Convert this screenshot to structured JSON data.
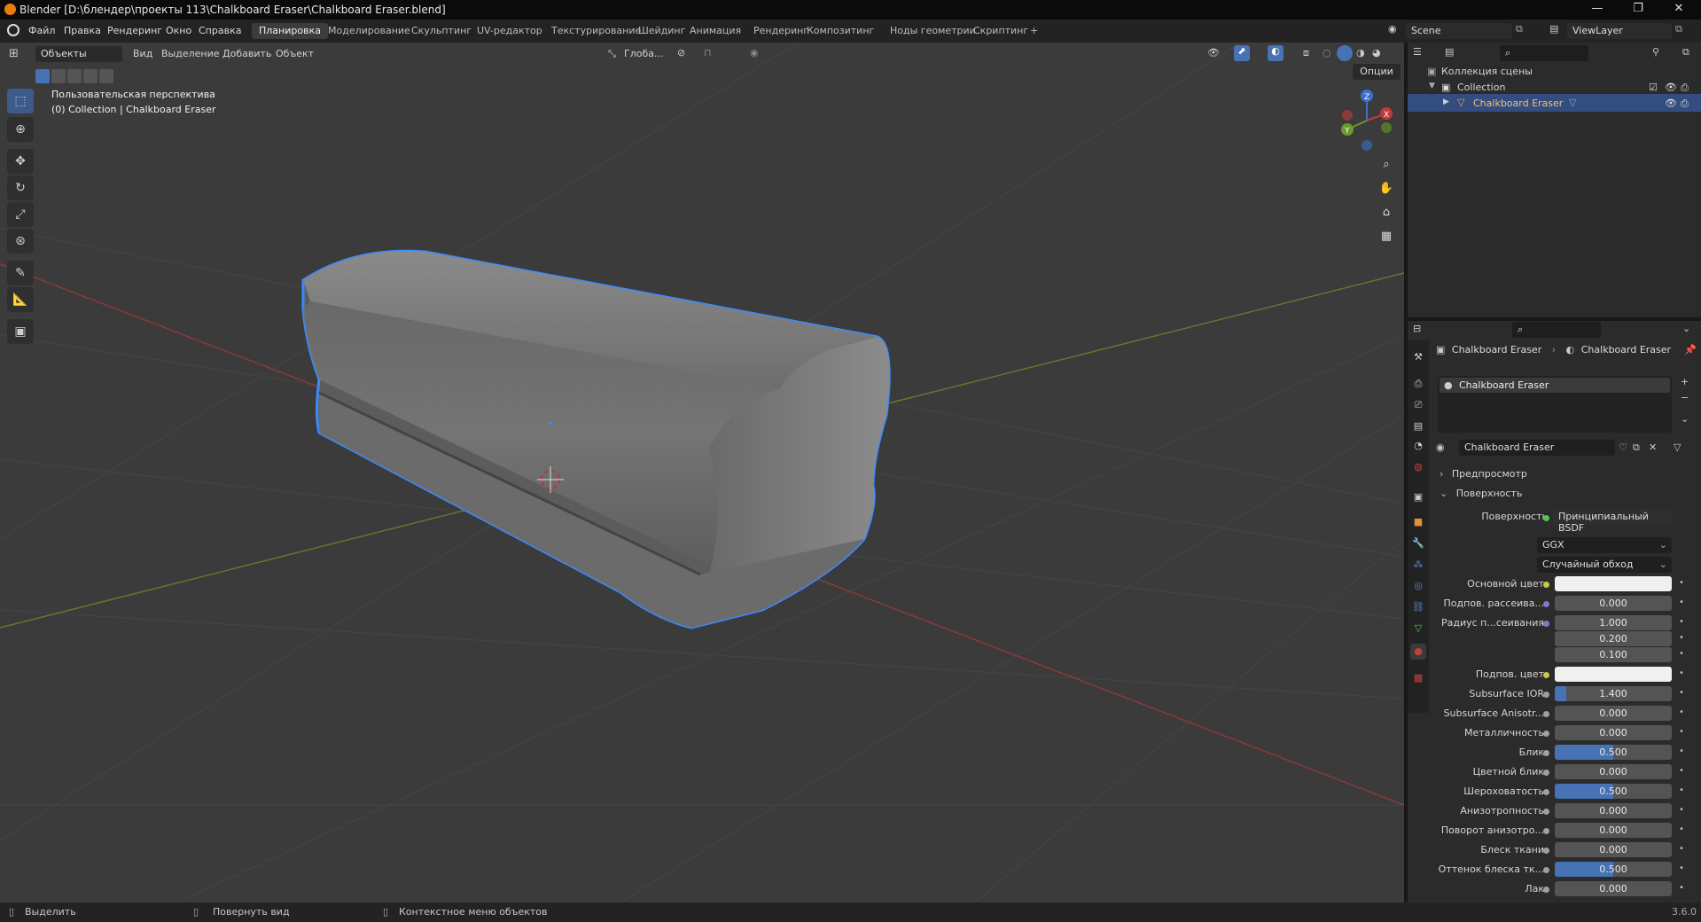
{
  "window": {
    "title": "Blender [D:\\блендер\\проекты 113\\Chalkboard Eraser\\Chalkboard Eraser.blend]",
    "minimize": "—",
    "maximize": "❐",
    "close": "✕"
  },
  "menu": {
    "items": [
      "Файл",
      "Правка",
      "Рендеринг",
      "Окно",
      "Справка"
    ],
    "workspaces": [
      "Планировка",
      "Моделирование",
      "Скульптинг",
      "UV-редактор",
      "Текстурирование",
      "Шейдинг",
      "Анимация",
      "Рендеринг",
      "Композитинг",
      "Ноды геометрии",
      "Скриптинг",
      "+"
    ],
    "active_workspace_index": 0,
    "scene_label": "Scene",
    "viewlayer_label": "ViewLayer"
  },
  "viewport": {
    "mode": "Объекты",
    "header_menus": [
      "Вид",
      "Выделение",
      "Добавить",
      "Объект"
    ],
    "transform_orientation": "Глоба...",
    "options": "Опции",
    "view_name": "Пользовательская перспектива",
    "collection_info": "(0) Collection | Chalkboard Eraser",
    "gizmo_labels": {
      "x": "X",
      "y": "Y",
      "z": "Z"
    }
  },
  "outliner": {
    "scene_collection": "Коллекция сцены",
    "collection": "Collection",
    "object": "Chalkboard Eraser"
  },
  "properties": {
    "breadcrumb_object": "Chalkboard Eraser",
    "breadcrumb_material": "Chalkboard Eraser",
    "slot_name": "Chalkboard Eraser",
    "material_name": "Chalkboard Eraser",
    "sections": {
      "preview": "Предпросмотр",
      "surface": "Поверхность"
    },
    "surface_label": "Поверхность",
    "surface_value": "Принципиальный BSDF",
    "distribution": "GGX",
    "subsurface_method": "Случайный обход",
    "fields": [
      {
        "label": "Основной цвет",
        "value": "",
        "type": "color",
        "color": "#f0f0f0",
        "dot": "#c8c84a"
      },
      {
        "label": "Подпов. рассеива...",
        "value": "0.000",
        "type": "num",
        "fill": 0,
        "dot": "#7a7acc"
      },
      {
        "label": "Радиус п...сеивания",
        "value": "1.000",
        "type": "num",
        "fill": 0,
        "dot": "#7a7acc"
      },
      {
        "label": "",
        "value": "0.200",
        "type": "num",
        "fill": 0,
        "dot": ""
      },
      {
        "label": "",
        "value": "0.100",
        "type": "num",
        "fill": 0,
        "dot": ""
      },
      {
        "label": "Подпов. цвет",
        "value": "",
        "type": "color",
        "color": "#f0f0f0",
        "dot": "#c8c84a"
      },
      {
        "label": "Subsurface IOR",
        "value": "1.400",
        "type": "num",
        "fill": 0.1,
        "dot": "#a0a0a0"
      },
      {
        "label": "Subsurface Anisotr...",
        "value": "0.000",
        "type": "num",
        "fill": 0,
        "dot": "#a0a0a0"
      },
      {
        "label": "Металличность",
        "value": "0.000",
        "type": "num",
        "fill": 0,
        "dot": "#a0a0a0"
      },
      {
        "label": "Блик",
        "value": "0.500",
        "type": "num",
        "fill": 0.5,
        "dot": "#a0a0a0"
      },
      {
        "label": "Цветной блик",
        "value": "0.000",
        "type": "num",
        "fill": 0,
        "dot": "#a0a0a0"
      },
      {
        "label": "Шероховатость",
        "value": "0.500",
        "type": "num",
        "fill": 0.5,
        "dot": "#a0a0a0"
      },
      {
        "label": "Анизотропность",
        "value": "0.000",
        "type": "num",
        "fill": 0,
        "dot": "#a0a0a0"
      },
      {
        "label": "Поворот анизотро...",
        "value": "0.000",
        "type": "num",
        "fill": 0,
        "dot": "#a0a0a0"
      },
      {
        "label": "Блеск ткани",
        "value": "0.000",
        "type": "num",
        "fill": 0,
        "dot": "#a0a0a0"
      },
      {
        "label": "Оттенок блеска тк...",
        "value": "0.500",
        "type": "num",
        "fill": 0.5,
        "dot": "#a0a0a0"
      },
      {
        "label": "Лак",
        "value": "0.000",
        "type": "num",
        "fill": 0,
        "dot": "#a0a0a0"
      }
    ]
  },
  "status": {
    "select": "Выделить",
    "rotate": "Повернуть вид",
    "context": "Контекстное меню объектов",
    "version": "3.6.0"
  },
  "colors": {
    "accent": "#4772b3",
    "selection_outline": "#3a8bff",
    "viewport_bg": "#3b3b3b",
    "panel_bg": "#2b2b2b"
  }
}
